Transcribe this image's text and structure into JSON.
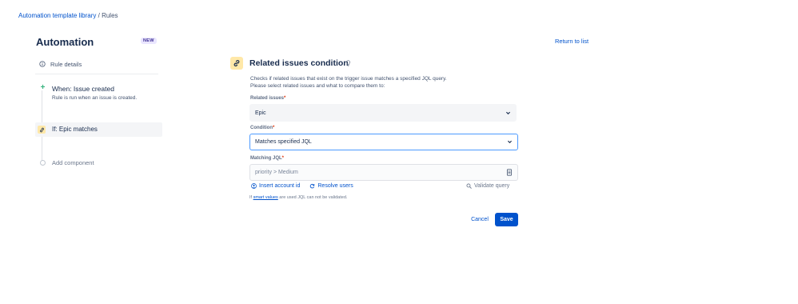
{
  "breadcrumb": {
    "link": "Automation template library",
    "separator": " / ",
    "current": "Rules"
  },
  "header": {
    "title": "Automation",
    "badge": "NEW",
    "return_link": "Return to list"
  },
  "sidebar": {
    "rule_details": "Rule details",
    "trigger": {
      "title": "When: Issue created",
      "description": "Rule is run when an issue is created."
    },
    "condition": {
      "title": "If: Epic matches"
    },
    "add_component": "Add component"
  },
  "panel": {
    "title": "Related issues condition",
    "description_line1": "Checks if related issues that exist on the trigger issue matches a specified JQL query.",
    "description_line2": "Please select related issues and what to compare them to:",
    "related_issues": {
      "label": "Related issues",
      "required": "*",
      "value": "Epic"
    },
    "condition": {
      "label": "Condition",
      "required": "*",
      "value": "Matches specified JQL"
    },
    "matching_jql": {
      "label": "Matching JQL",
      "required": "*",
      "placeholder": "priority > Medium"
    },
    "insert_account_id": "Insert account id",
    "resolve_users": "Resolve users",
    "validate_query": "Validate query",
    "note_prefix": "If ",
    "note_link": "smart values",
    "note_suffix": " are used JQL can not be validated.",
    "cancel": "Cancel",
    "save": "Save"
  },
  "colors": {
    "accent": "#0052cc",
    "condition_icon_bg": "#ffe8a8",
    "trigger_green": "#36b37e",
    "badge_bg": "#eae6ff",
    "badge_text": "#403294",
    "focus_border": "#4c9aff"
  }
}
